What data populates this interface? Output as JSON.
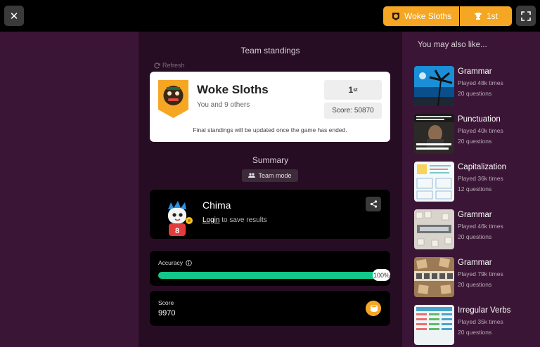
{
  "topbar": {
    "close_icon": "close-icon",
    "team_name": "Woke Sloths",
    "rank": "1st",
    "fullscreen_icon": "fullscreen-icon"
  },
  "standings": {
    "title": "Team standings",
    "refresh_label": "Refresh",
    "team_name": "Woke Sloths",
    "members": "You and 9 others",
    "rank_number": "1",
    "rank_suffix": "st",
    "score": "Score: 50870",
    "note": "Final standings will be updated once the game has ended."
  },
  "summary": {
    "title": "Summary",
    "mode_label": "Team mode"
  },
  "player": {
    "name": "Chima",
    "login_link": "Login",
    "login_suffix": " to save results"
  },
  "accuracy": {
    "label": "Accuracy",
    "percent_text": "100%",
    "value": 100
  },
  "score": {
    "label": "Score",
    "value": "9970"
  },
  "recommendations": {
    "header": "You may also like...",
    "items": [
      {
        "title": "Grammar",
        "played": "Played 48k times",
        "questions": "20 questions",
        "thumb": "palm-beach"
      },
      {
        "title": "Punctuation",
        "played": "Played 40k times",
        "questions": "20 questions",
        "thumb": "meme-dark"
      },
      {
        "title": "Capitalization",
        "played": "Played 36k times",
        "questions": "12 questions",
        "thumb": "worksheet"
      },
      {
        "title": "Grammar",
        "played": "Played 46k times",
        "questions": "20 questions",
        "thumb": "letter-tiles"
      },
      {
        "title": "Grammar",
        "played": "Played 79k times",
        "questions": "20 questions",
        "thumb": "wood-tiles"
      },
      {
        "title": "Irregular Verbs",
        "played": "Played 35k times",
        "questions": "20 questions",
        "thumb": "verb-chart"
      }
    ]
  },
  "colors": {
    "accent": "#f5a623",
    "progress": "#13c68a",
    "panel": "#3b1536",
    "center": "#270d24"
  }
}
